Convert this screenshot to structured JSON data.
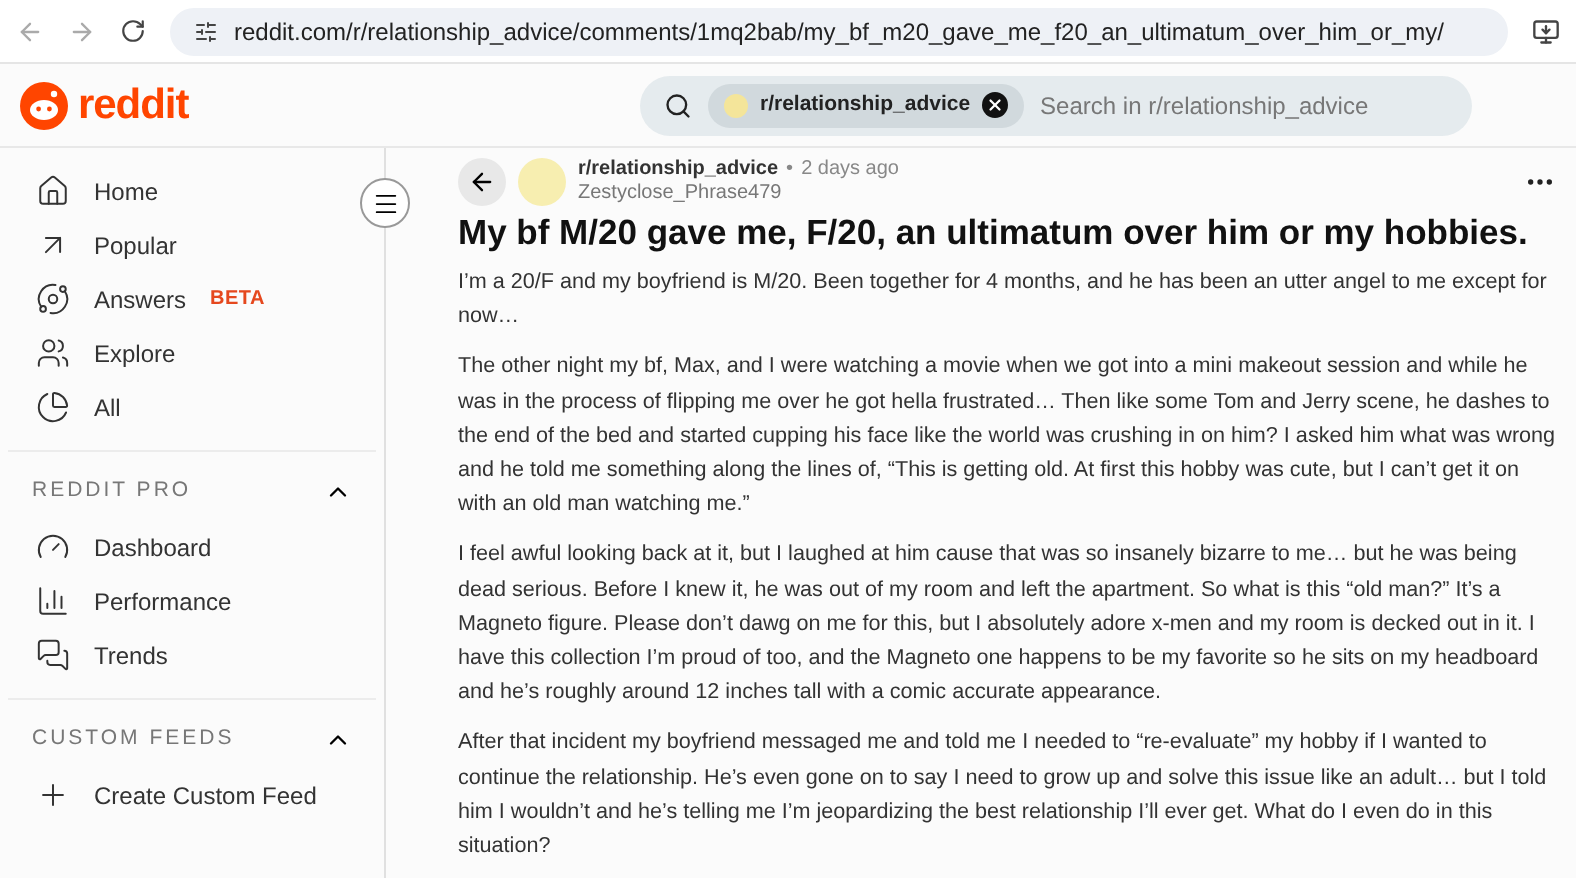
{
  "browser": {
    "url": "reddit.com/r/relationship_advice/comments/1mq2bab/my_bf_m20_gave_me_f20_an_ultimatum_over_him_or_my/"
  },
  "header": {
    "logo_text": "reddit",
    "search": {
      "chip": "r/relationship_advice",
      "placeholder": "Search in r/relationship_advice"
    }
  },
  "sidebar": {
    "nav": [
      {
        "label": "Home"
      },
      {
        "label": "Popular"
      },
      {
        "label": "Answers",
        "badge": "BETA"
      },
      {
        "label": "Explore"
      },
      {
        "label": "All"
      }
    ],
    "sections": [
      {
        "title": "REDDIT PRO",
        "expanded": true,
        "items": [
          {
            "label": "Dashboard"
          },
          {
            "label": "Performance"
          },
          {
            "label": "Trends"
          }
        ]
      },
      {
        "title": "CUSTOM FEEDS",
        "expanded": true,
        "items": [
          {
            "label": "Create Custom Feed"
          }
        ]
      }
    ]
  },
  "post": {
    "subreddit": "r/relationship_advice",
    "separator": "•",
    "time": "2 days ago",
    "author": "Zestyclose_Phrase479",
    "title": "My bf M/20 gave me, F/20, an ultimatum over him or my hobbies.",
    "paragraphs": [
      "I’m a 20/F and my boyfriend is M/20. Been together for 4 months, and he has been an utter angel to me except for now…",
      "The other night my bf, Max, and I were watching a movie when we got into a mini makeout session and while he was in the process of flipping me over he got hella frustrated… Then like some Tom and Jerry scene, he dashes to the end of the bed and started cupping his face like the world was crushing in on him? I asked him what was wrong and he told me something along the lines of, “This is getting old. At first this hobby was cute, but I can’t get it on with an old man watching me.”",
      "I feel awful looking back at it, but I laughed at him cause that was so insanely bizarre to me… but he was being dead serious. Before I knew it, he was out of my room and left the apartment. So what is this “old man?” It’s a Magneto figure. Please don’t dawg on me for this, but I absolutely adore x-men and my room is decked out in it. I have this collection I’m proud of too, and the Magneto one happens to be my favorite so he sits on my headboard and he’s roughly around 12 inches tall with a comic accurate appearance.",
      "After that incident my boyfriend messaged me and told me I needed to “re-evaluate” my hobby if I wanted to continue the relationship. He’s even gone on to say I need to grow up and solve this issue like an adult… but I told him I wouldn’t and he’s telling me I’m jeopardizing the best relationship I’ll ever get. What do I even do in this situation?"
    ]
  }
}
